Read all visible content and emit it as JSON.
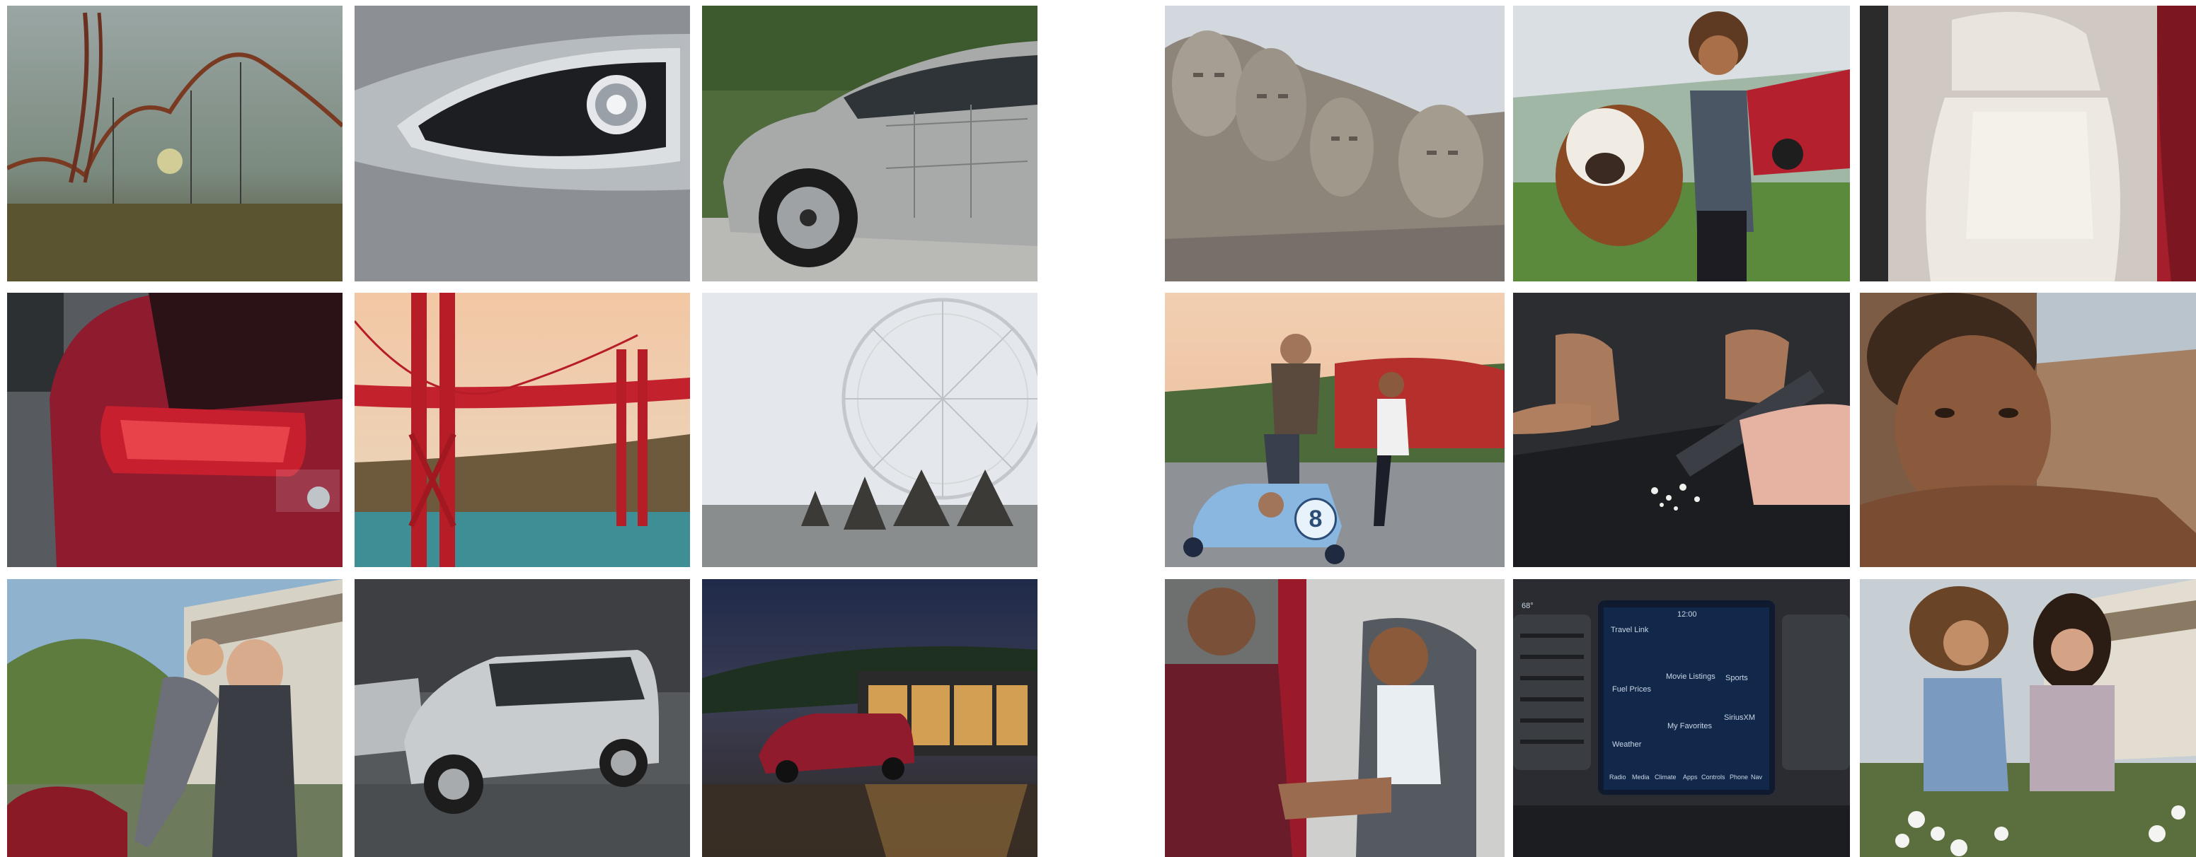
{
  "collage": {
    "left_panel": [
      "roller-coaster-night",
      "car-fog-light-closeup",
      "minivan-steel-body",
      "minivan-tail-light",
      "golden-gate-bridge",
      "ferris-wheel",
      "mother-hugging-child",
      "minivan-city-street",
      "minivan-night-rain"
    ],
    "right_panel": [
      "mount-rushmore",
      "child-with-saint-bernard",
      "minivan-seat-interior",
      "father-son-soapbox-race",
      "vacuum-cleaning-car-floor",
      "child-portrait-resting",
      "father-child-car-seat",
      "infotainment-touchscreen",
      "mother-daughter-gardening"
    ]
  },
  "soapbox_car": {
    "number": "8"
  },
  "infotainment": {
    "temperature": "68°",
    "clock": "12:00",
    "app_title": "Travel Link",
    "apps": [
      "Fuel Prices",
      "Movie Listings",
      "Sports",
      "Weather",
      "My Favorites",
      "SiriusXM"
    ],
    "dock": [
      "Radio",
      "Media",
      "Climate",
      "Apps",
      "Controls",
      "Phone",
      "Nav"
    ]
  }
}
